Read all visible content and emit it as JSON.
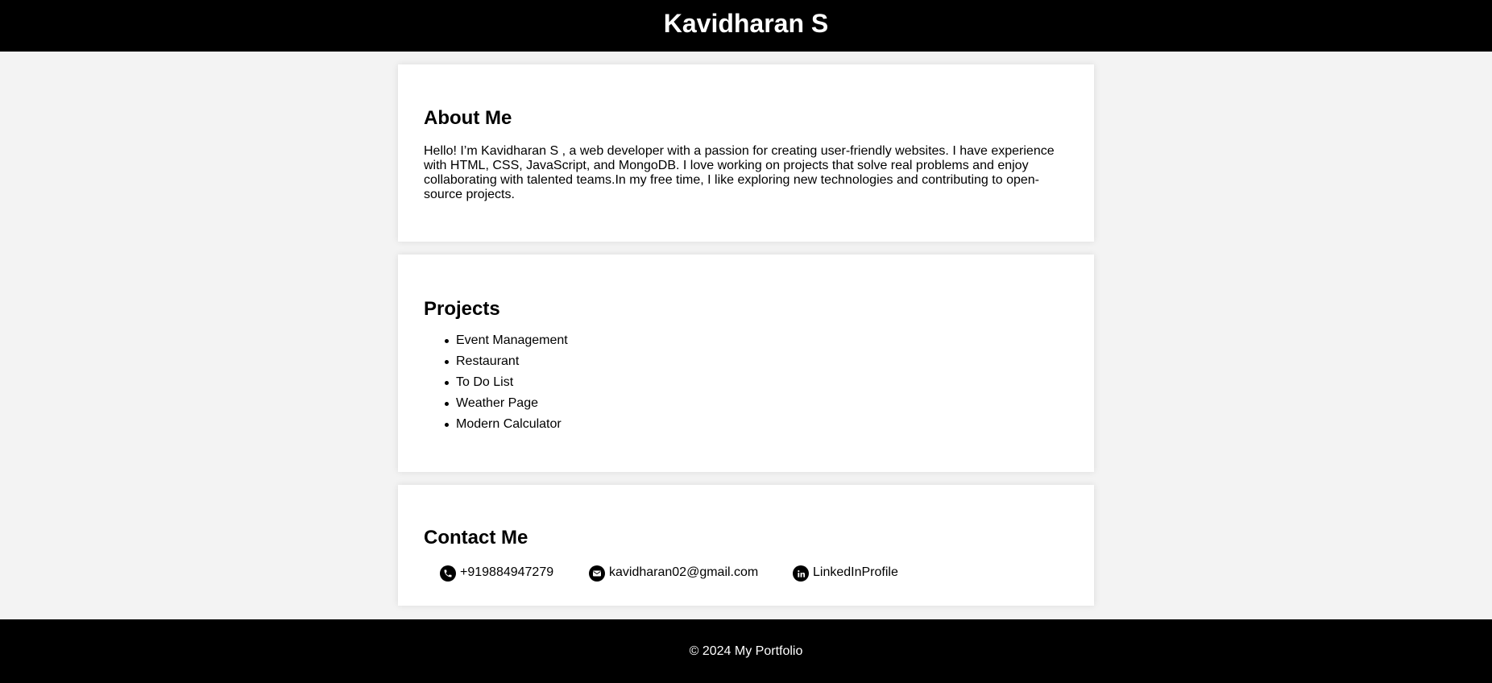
{
  "header": {
    "title": "Kavidharan S"
  },
  "about": {
    "heading": "About Me",
    "text": "Hello! I’m Kavidharan S , a web developer with a passion for creating user-friendly websites. I have experience with HTML, CSS, JavaScript, and MongoDB. I love working on projects that solve real problems and enjoy collaborating with talented teams.In my free time, I like exploring new technologies and contributing to open-source projects."
  },
  "projects": {
    "heading": "Projects",
    "items": [
      "Event Management",
      "Restaurant",
      "To Do List",
      "Weather Page",
      "Modern Calculator"
    ]
  },
  "contact": {
    "heading": "Contact Me",
    "phone": "+919884947279",
    "email": "kavidharan02@gmail.com",
    "linkedin": "LinkedInProfile"
  },
  "footer": {
    "text": "© 2024 My Portfolio"
  },
  "icons": {
    "phone": "phone-icon",
    "email": "email-icon",
    "linkedin": "linkedin-icon"
  },
  "colors": {
    "header_bg": "#000000",
    "page_bg": "#f3f3f3",
    "card_bg": "#ffffff",
    "text": "#000000"
  }
}
